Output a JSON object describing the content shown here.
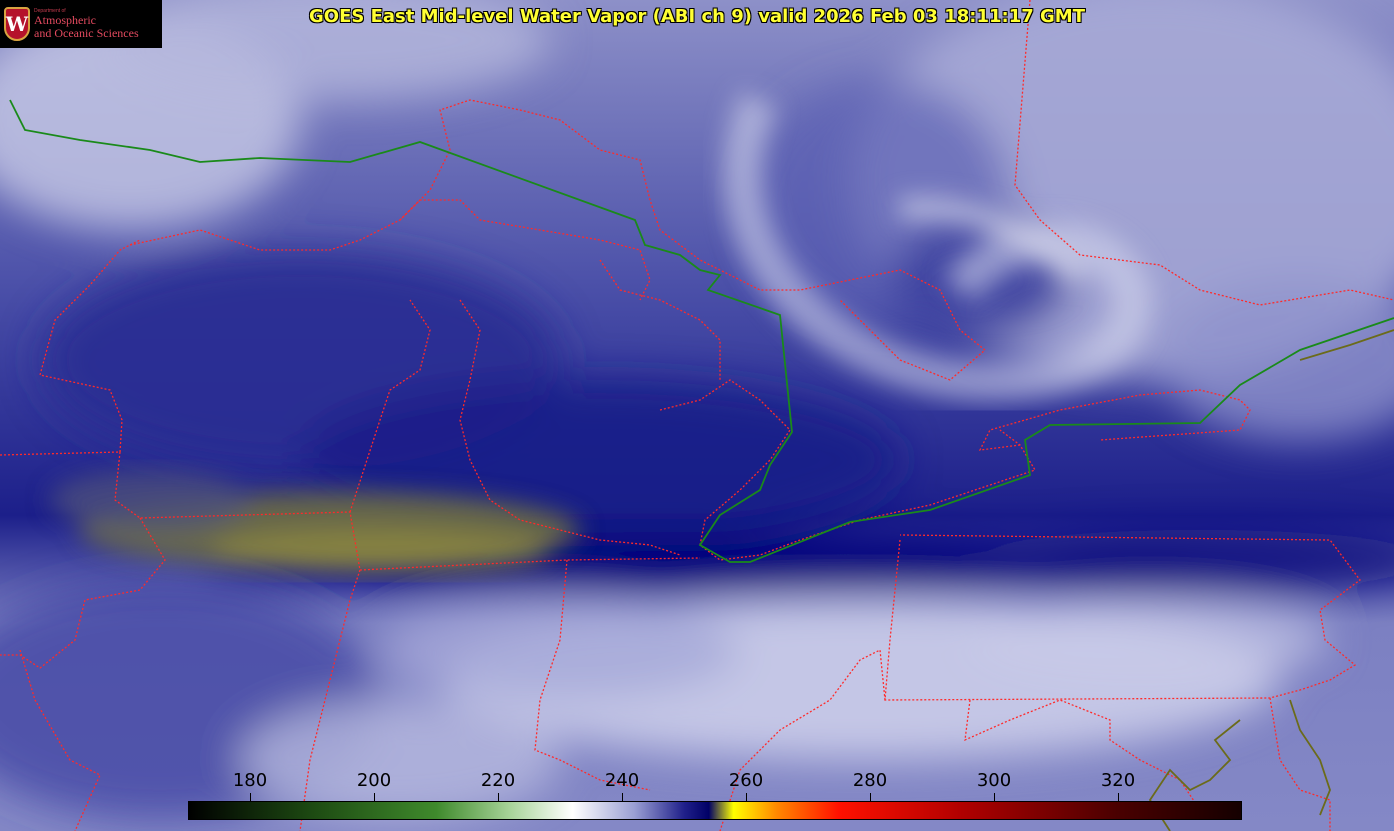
{
  "logo": {
    "department": "Department of",
    "line1": "Atmospheric",
    "line2": "and Oceanic Sciences",
    "emblem_letter": "W",
    "icon": "uw-crest-icon"
  },
  "title": "GOES East Mid-level Water Vapor (ABI ch 9)  valid 2026 Feb 03 18:11:17 GMT",
  "colorbar": {
    "unit_range": [
      170,
      340
    ],
    "ticks": [
      "180",
      "200",
      "220",
      "240",
      "260",
      "280",
      "300",
      "320"
    ],
    "tick_values": [
      180,
      200,
      220,
      240,
      260,
      280,
      300,
      320
    ],
    "stops": [
      {
        "value": 170,
        "color": "#000000"
      },
      {
        "value": 190,
        "color": "#1d4a12"
      },
      {
        "value": 210,
        "color": "#3f8a2c"
      },
      {
        "value": 222,
        "color": "#a9d49a"
      },
      {
        "value": 232,
        "color": "#ffffff"
      },
      {
        "value": 242,
        "color": "#9a9fd3"
      },
      {
        "value": 250,
        "color": "#20208a"
      },
      {
        "value": 254,
        "color": "#000066"
      },
      {
        "value": 258,
        "color": "#ffff00"
      },
      {
        "value": 265,
        "color": "#ff8800"
      },
      {
        "value": 275,
        "color": "#ff1100"
      },
      {
        "value": 295,
        "color": "#b00000"
      },
      {
        "value": 320,
        "color": "#4a0000"
      },
      {
        "value": 340,
        "color": "#150000"
      }
    ]
  },
  "colors": {
    "border": "#ff2a2a",
    "intl_border": "#1a8a1a",
    "coast": "#6b6b1a",
    "dry_band": "#00007a",
    "moist": "#d8dbee",
    "title": "#ffff33"
  }
}
